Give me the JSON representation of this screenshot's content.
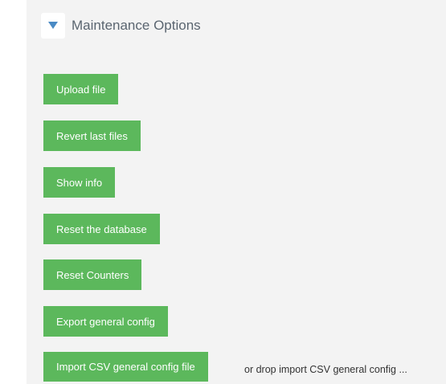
{
  "panel": {
    "title": "Maintenance Options",
    "toggle_icon": "triangle-down-icon",
    "accent_color": "#4a8ac4",
    "button_color": "#5cb85c"
  },
  "buttons": {
    "upload_file": "Upload file",
    "revert_last_files": "Revert last files",
    "show_info": "Show info",
    "reset_database": "Reset the database",
    "reset_counters": "Reset Counters",
    "export_general_config": "Export general config",
    "import_csv_general_config": "Import CSV general config file"
  },
  "drop_hint": "or drop import CSV general config ..."
}
